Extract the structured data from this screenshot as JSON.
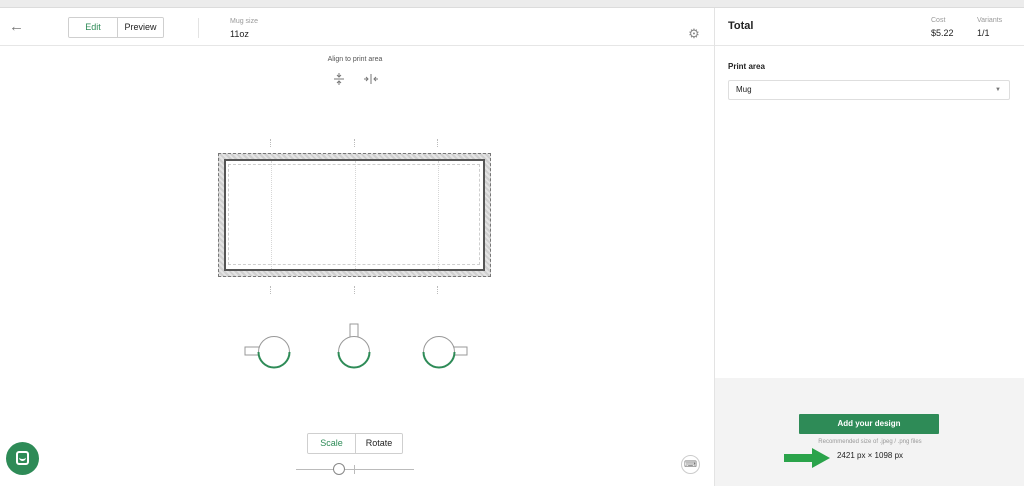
{
  "header": {
    "mode_edit": "Edit",
    "mode_preview": "Preview",
    "mug_size_label": "Mug size",
    "mug_size_value": "11oz"
  },
  "canvas": {
    "align_title": "Align to print area",
    "transform_scale": "Scale",
    "transform_rotate": "Rotate",
    "scale_level": 0.35
  },
  "panel": {
    "title": "Total",
    "cost_label": "Cost",
    "cost_value": "$5.22",
    "variants_label": "Variants",
    "variants_value": "1/1",
    "print_area_label": "Print area",
    "print_area_value": "Mug",
    "add_design_label": "Add your design",
    "recommended_text": "Recommended size of .jpeg / .png files",
    "recommended_size": "2421 px × 1098 px"
  },
  "colors": {
    "accent": "#2e8b57",
    "arrow": "#2aa34a"
  },
  "icons": [
    "arrow-left-icon",
    "gear-icon",
    "align-vertical-center-icon",
    "align-horizontal-center-icon",
    "chat-icon",
    "keyboard-icon"
  ]
}
